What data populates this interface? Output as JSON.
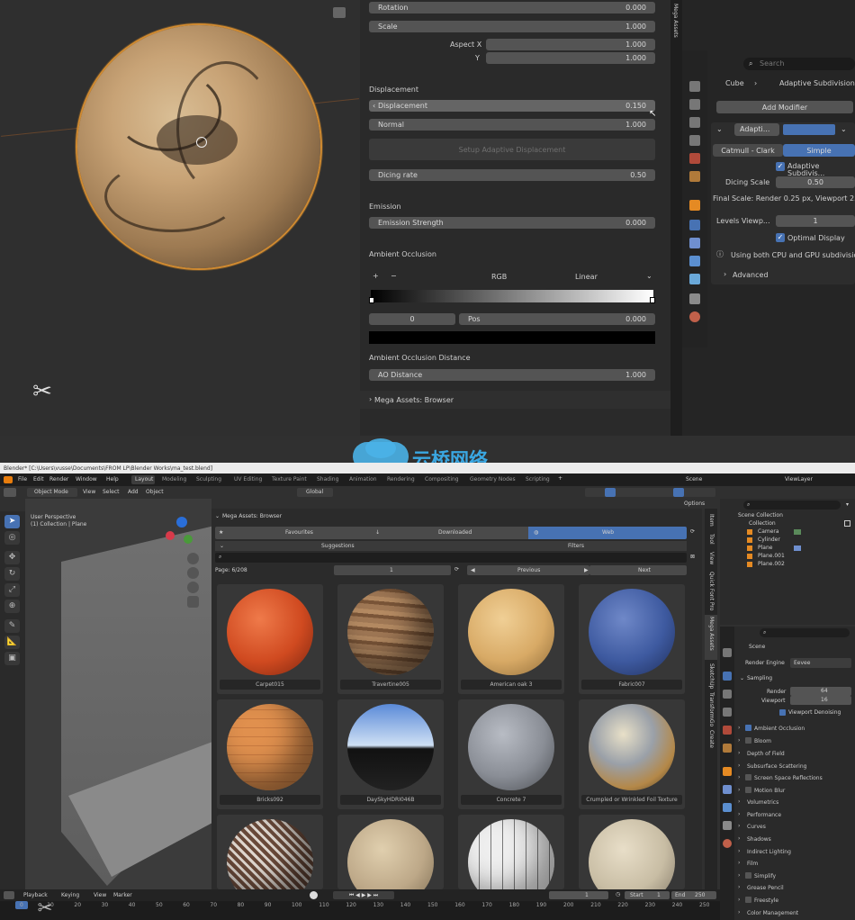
{
  "colors": {
    "accent": "#4772b3",
    "select_orange": "#e58a23",
    "bg": "#303030",
    "panel": "#2b2b2b",
    "field": "#545454"
  },
  "top": {
    "rows": [
      {
        "label": "Rotation",
        "value": "0.000"
      },
      {
        "label": "Scale",
        "value": "1.000"
      }
    ],
    "aspect_x_label": "Aspect X",
    "aspect_x_value": "1.000",
    "aspect_y_label": "Y",
    "aspect_y_value": "1.000",
    "displacement_section": "Displacement",
    "displacement_label": "Displacement",
    "displacement_value": "0.150",
    "normal_label": "Normal",
    "normal_value": "1.000",
    "setup_button": "Setup Adaptive Displacement",
    "dicing_label": "Dicing rate",
    "dicing_value": "0.50",
    "emission_section": "Emission",
    "emission_label": "Emission Strength",
    "emission_value": "0.000",
    "ao_section": "Ambient Occlusion",
    "ramp_add": "+",
    "ramp_remove": "−",
    "ramp_mode": "RGB",
    "ramp_interp": "Linear",
    "ramp_index": "0",
    "ramp_pos_label": "Pos",
    "ramp_pos_value": "0.000",
    "ao_distance_section": "Ambient Occlusion Distance",
    "ao_distance_label": "AO Distance",
    "ao_distance_value": "1.000",
    "mega_assets_section": "Mega Assets: Browser",
    "side_tab": "Mega Assets",
    "modifier": {
      "search_placeholder": "Search",
      "breadcrumb_object": "Cube",
      "breadcrumb_mod": "Adaptive Subdivision",
      "add_button": "Add Modifier",
      "mod_name": "Adapti...",
      "catmull": "Catmull - Clark",
      "simple": "Simple",
      "adaptive_check": "Adaptive Subdivis...",
      "dicing_label": "Dicing Scale",
      "dicing_value": "0.50",
      "final_scale": "Final Scale: Render 0.25 px, Viewport 2...",
      "levels_label": "Levels Viewp...",
      "levels_value": "1",
      "optimal_display": "Optimal Display",
      "info": "Using both CPU and GPU subdivision",
      "advanced": "Advanced"
    }
  },
  "watermark": "云桥网络",
  "app": {
    "title": "Blender* [C:\\Users\\vusse\\Documents\\FROM LP\\Blender Works\\ma_test.blend]",
    "menus": [
      "File",
      "Edit",
      "Render",
      "Window",
      "Help"
    ],
    "workspaces": [
      "Layout",
      "Modeling",
      "Sculpting",
      "UV Editing",
      "Texture Paint",
      "Shading",
      "Animation",
      "Rendering",
      "Compositing",
      "Geometry Nodes",
      "Scripting"
    ],
    "scene": "Scene",
    "view_layer": "ViewLayer",
    "mode": "Object Mode",
    "hdr_menus": [
      "View",
      "Select",
      "Add",
      "Object"
    ],
    "transform": "Global",
    "options": "Options"
  },
  "viewport": {
    "line1": "User Perspective",
    "line2": "(1) Collection | Plane"
  },
  "browser": {
    "header": "Mega Assets: Browser",
    "tabs": [
      "Favourites",
      "Downloaded",
      "Web"
    ],
    "suggestions": "Suggestions",
    "filters": "Filters",
    "page_label": "Page: 6/208",
    "page_value": "1",
    "prev": "Previous",
    "next": "Next",
    "assets": [
      "Carpet015",
      "Travertine005",
      "American oak 3",
      "Fabric007",
      "Bricks092",
      "DaySkyHDRI046B",
      "Concrete 7",
      "Crumpled or Wrinkled Foil Texture",
      "",
      "",
      "",
      ""
    ]
  },
  "vtabs": [
    "Item",
    "Tool",
    "View",
    "Quick Font Pro",
    "Mega Assets",
    "SketchUp",
    "TransformGo",
    "Create"
  ],
  "outliner": {
    "title": "Scene Collection",
    "items": [
      "Collection",
      "Camera",
      "Cylinder",
      "Plane",
      "Plane.001",
      "Plane.002"
    ]
  },
  "render_props": {
    "scene": "Scene",
    "engine_label": "Render Engine",
    "engine_value": "Eevee",
    "sampling": "Sampling",
    "render_label": "Render",
    "render_value": "64",
    "viewport_label": "Viewport",
    "viewport_value": "16",
    "denoise": "Viewport Denoising",
    "panels": [
      "Ambient Occlusion",
      "Bloom",
      "Depth of Field",
      "Subsurface Scattering",
      "Screen Space Reflections",
      "Motion Blur",
      "Volumetrics",
      "Performance",
      "Curves",
      "Shadows",
      "Indirect Lighting",
      "Film",
      "Simplify",
      "Grease Pencil",
      "Freestyle",
      "Color Management"
    ]
  },
  "timeline": {
    "menus": [
      "Playback",
      "Keying",
      "View",
      "Marker"
    ],
    "frame": "1",
    "start_label": "Start",
    "start_value": "1",
    "end_label": "End",
    "end_value": "250",
    "ticks": [
      "0",
      "10",
      "20",
      "30",
      "40",
      "50",
      "60",
      "70",
      "80",
      "90",
      "100",
      "110",
      "120",
      "130",
      "140",
      "150",
      "160",
      "170",
      "180",
      "190",
      "200",
      "210",
      "220",
      "230",
      "240",
      "250"
    ]
  }
}
